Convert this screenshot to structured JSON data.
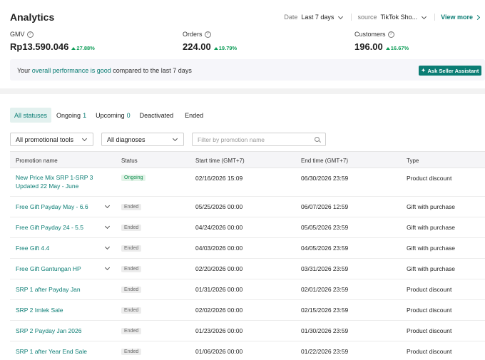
{
  "analytics": {
    "title": "Analytics",
    "date_label": "Date",
    "date_value": "Last 7 days",
    "source_label": "source",
    "source_value": "TikTok Sho...",
    "view_more": "View more",
    "metrics": [
      {
        "label": "GMV",
        "value": "Rp13.590.046",
        "delta": "27.88%"
      },
      {
        "label": "Orders",
        "value": "224.00",
        "delta": "19.79%"
      },
      {
        "label": "Customers",
        "value": "196.00",
        "delta": "16.67%"
      }
    ],
    "performance": {
      "prefix": "Your ",
      "highlight": "overall performance is good",
      "suffix": " compared to the last 7 days",
      "ask_button": "Ask Seller Assistant"
    }
  },
  "promotions": {
    "tabs": [
      {
        "label": "All statuses",
        "count": ""
      },
      {
        "label": "Ongoing",
        "count": "1"
      },
      {
        "label": "Upcoming",
        "count": "0"
      },
      {
        "label": "Deactivated",
        "count": ""
      },
      {
        "label": "Ended",
        "count": ""
      }
    ],
    "filters": {
      "tools": "All promotional tools",
      "diagnoses": "All diagnoses",
      "search_placeholder": "Filter by promotion name"
    },
    "columns": [
      "Promotion name",
      "Status",
      "Start time (GMT+7)",
      "End time (GMT+7)",
      "Type"
    ],
    "rows": [
      {
        "name": "New Price Mix SRP 1-SRP 3",
        "name2": "Updated 22 May - June",
        "status": "Ongoing",
        "start": "02/16/2026 15:09",
        "end": "06/30/2026 23:59",
        "type": "Product discount"
      },
      {
        "name": "Free Gift Payday May - 6.6",
        "name2": "",
        "status": "Ended",
        "start": "05/25/2026 00:00",
        "end": "06/07/2026 12:59",
        "type": "Gift with purchase"
      },
      {
        "name": "Free Gift Payday 24 - 5.5",
        "name2": "",
        "status": "Ended",
        "start": "04/24/2026 00:00",
        "end": "05/05/2026 23:59",
        "type": "Gift with purchase"
      },
      {
        "name": "Free Gift 4.4",
        "name2": "",
        "status": "Ended",
        "start": "04/03/2026 00:00",
        "end": "04/05/2026 23:59",
        "type": "Gift with purchase"
      },
      {
        "name": "Free Gift Gantungan HP",
        "name2": "",
        "status": "Ended",
        "start": "02/20/2026 00:00",
        "end": "03/31/2026 23:59",
        "type": "Gift with purchase"
      },
      {
        "name": "SRP 1 after Payday Jan",
        "name2": "",
        "status": "Ended",
        "start": "01/31/2026 00:00",
        "end": "02/01/2026 23:59",
        "type": "Product discount"
      },
      {
        "name": "SRP 2 Imlek Sale",
        "name2": "",
        "status": "Ended",
        "start": "02/02/2026 00:00",
        "end": "02/15/2026 23:59",
        "type": "Product discount"
      },
      {
        "name": "SRP 2 Payday Jan 2026",
        "name2": "",
        "status": "Ended",
        "start": "01/23/2026 00:00",
        "end": "01/30/2026 23:59",
        "type": "Product discount"
      },
      {
        "name": "SRP 1 after Year End Sale",
        "name2": "",
        "status": "Ended",
        "start": "01/06/2026 00:00",
        "end": "01/22/2026 23:59",
        "type": "Product discount"
      }
    ]
  },
  "colors": {
    "accent": "#0b7d74",
    "positive": "#0f9d58"
  }
}
